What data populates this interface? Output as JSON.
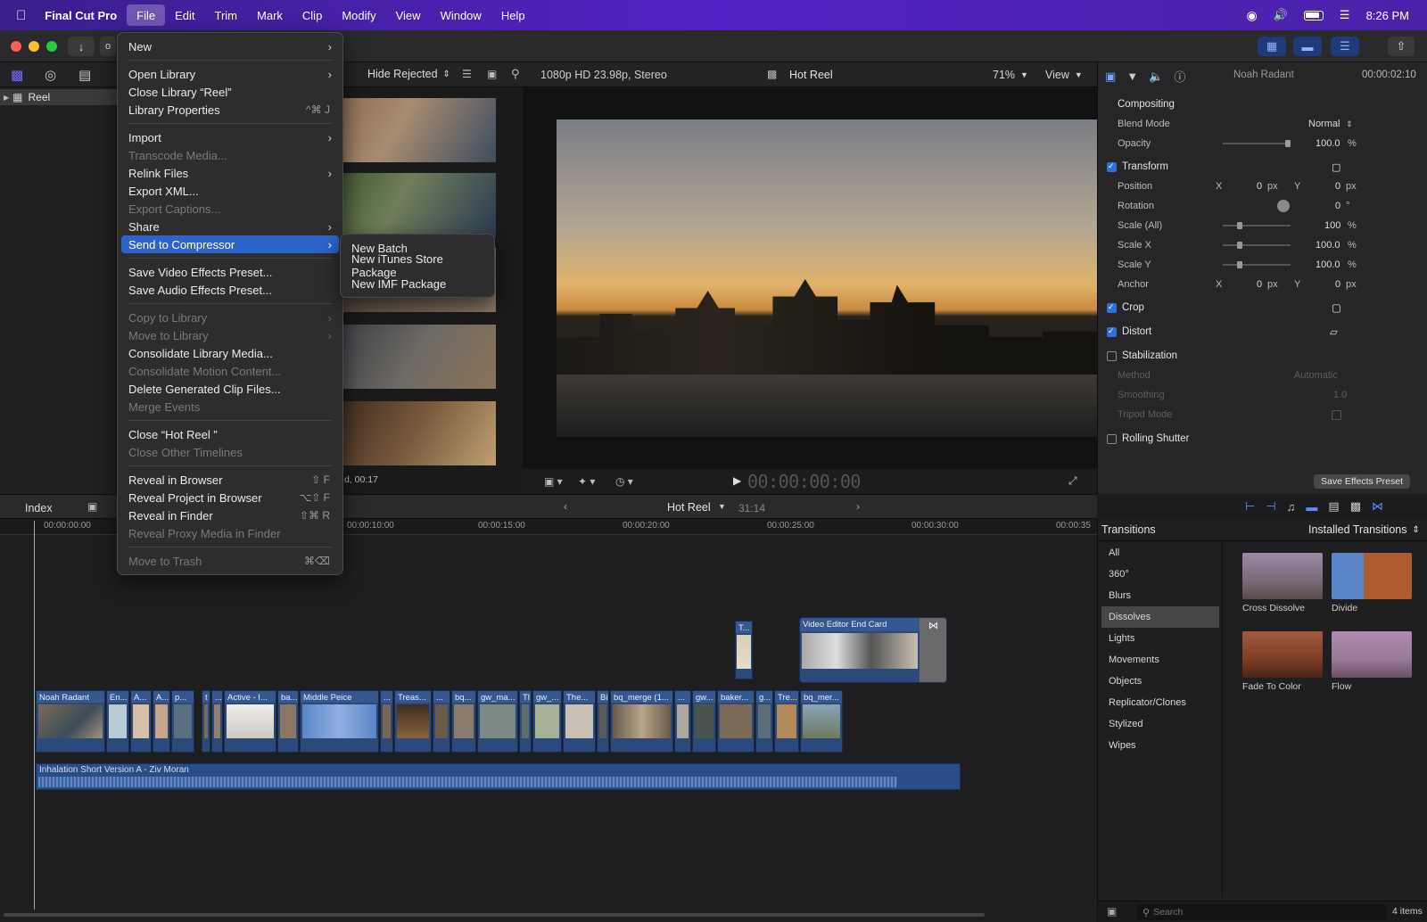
{
  "menubar": {
    "app": "Final Cut Pro",
    "items": [
      "File",
      "Edit",
      "Trim",
      "Mark",
      "Clip",
      "Modify",
      "View",
      "Window",
      "Help"
    ],
    "clock": "8:26 PM"
  },
  "toolbar": {
    "library_label": "Reel",
    "hide_rejected": "Hide Rejected",
    "format": "1080p HD 23.98p, Stereo",
    "project": "Hot Reel",
    "zoom": "71%",
    "view": "View",
    "clip_name": "Noah Radant",
    "timecode_right": "00:00:02:10"
  },
  "browser": {
    "status": "d, 00:17"
  },
  "viewer": {
    "timecode": "00:00:00:00"
  },
  "inspector": {
    "compositing": "Compositing",
    "blend_mode_label": "Blend Mode",
    "blend_mode_value": "Normal",
    "opacity_label": "Opacity",
    "opacity_value": "100.0",
    "percent": "%",
    "transform": "Transform",
    "position_label": "Position",
    "x": "X",
    "y": "Y",
    "zero": "0",
    "px": "px",
    "rotation_label": "Rotation",
    "degree": "°",
    "scale_all_label": "Scale (All)",
    "scale_all_value": "100",
    "scale_x_label": "Scale X",
    "scale_x_value": "100.0",
    "scale_y_label": "Scale Y",
    "scale_y_value": "100.0",
    "anchor_label": "Anchor",
    "crop": "Crop",
    "distort": "Distort",
    "stabilization": "Stabilization",
    "method_label": "Method",
    "method_value": "Automatic",
    "smoothing_label": "Smoothing",
    "smoothing_value": "1.0",
    "tripod_label": "Tripod Mode",
    "rolling_shutter": "Rolling Shutter",
    "save_preset": "Save Effects Preset"
  },
  "timeline": {
    "index": "Index",
    "project": "Hot Reel",
    "duration": "31:14",
    "ruler": [
      "00:00:00:00",
      "00:00:10:00",
      "00:00:15:00",
      "00:00:20:00",
      "00:00:25:00",
      "00:00:30:00",
      "00:00:35"
    ],
    "connected_clips": [
      "T...",
      "Video Editor End Card"
    ],
    "clips": [
      "Noah Radant",
      "En...",
      "A...",
      "A...",
      "p...",
      "t",
      "...",
      "Active - I...",
      "ba...",
      "Middle Peice",
      "...",
      "Treas...",
      "...",
      "bq...",
      "gw_ma...",
      "Tl",
      "gw_...",
      "The...",
      "Bi",
      "bq_merge (1...",
      "...",
      "gw...",
      "baker...",
      "g...",
      "Tre...",
      "bq_mer..."
    ],
    "audio": "Inhalation   Short Version A - Ziv Moran"
  },
  "transitions": {
    "title": "Transitions",
    "source": "Installed Transitions",
    "categories": [
      "All",
      "360°",
      "Blurs",
      "Dissolves",
      "Lights",
      "Movements",
      "Objects",
      "Replicator/Clones",
      "Stylized",
      "Wipes"
    ],
    "items": [
      "Cross Dissolve",
      "Divide",
      "Fade To Color",
      "Flow"
    ],
    "search_placeholder": "Search",
    "count": "4 items"
  },
  "file_menu": {
    "items": [
      {
        "label": "New",
        "kind": "sub"
      },
      {
        "sep": true
      },
      {
        "label": "Open Library",
        "kind": "sub"
      },
      {
        "label": "Close Library “Reel”"
      },
      {
        "label": "Library Properties",
        "shortcut": "^⌘ J"
      },
      {
        "sep": true
      },
      {
        "label": "Import",
        "kind": "sub"
      },
      {
        "label": "Transcode Media...",
        "dis": true
      },
      {
        "label": "Relink Files",
        "kind": "sub"
      },
      {
        "label": "Export XML..."
      },
      {
        "label": "Export Captions...",
        "dis": true
      },
      {
        "label": "Share",
        "kind": "sub"
      },
      {
        "label": "Send to Compressor",
        "kind": "sub",
        "hl": true
      },
      {
        "sep": true
      },
      {
        "label": "Save Video Effects Preset..."
      },
      {
        "label": "Save Audio Effects Preset..."
      },
      {
        "sep": true
      },
      {
        "label": "Copy to Library",
        "kind": "sub",
        "dis": true
      },
      {
        "label": "Move to Library",
        "kind": "sub",
        "dis": true
      },
      {
        "label": "Consolidate Library Media..."
      },
      {
        "label": "Consolidate Motion Content...",
        "dis": true
      },
      {
        "label": "Delete Generated Clip Files..."
      },
      {
        "label": "Merge Events",
        "dis": true
      },
      {
        "sep": true
      },
      {
        "label": "Close “Hot Reel ”"
      },
      {
        "label": "Close Other Timelines",
        "dis": true
      },
      {
        "sep": true
      },
      {
        "label": "Reveal in Browser",
        "shortcut": "⇧ F"
      },
      {
        "label": "Reveal Project in Browser",
        "shortcut": "⌥⇧ F"
      },
      {
        "label": "Reveal in Finder",
        "shortcut": "⇧⌘ R"
      },
      {
        "label": "Reveal Proxy Media in Finder",
        "dis": true
      },
      {
        "sep": true
      },
      {
        "label": "Move to Trash",
        "shortcut": "⌘⌫",
        "dis": true
      }
    ]
  },
  "compressor_menu": {
    "items": [
      "New Batch",
      "New iTunes Store Package",
      "New IMF Package"
    ]
  },
  "colors": {
    "accent": "#2f63cc",
    "menubar": "#4a22a8",
    "clip": "#2b4a7a"
  }
}
